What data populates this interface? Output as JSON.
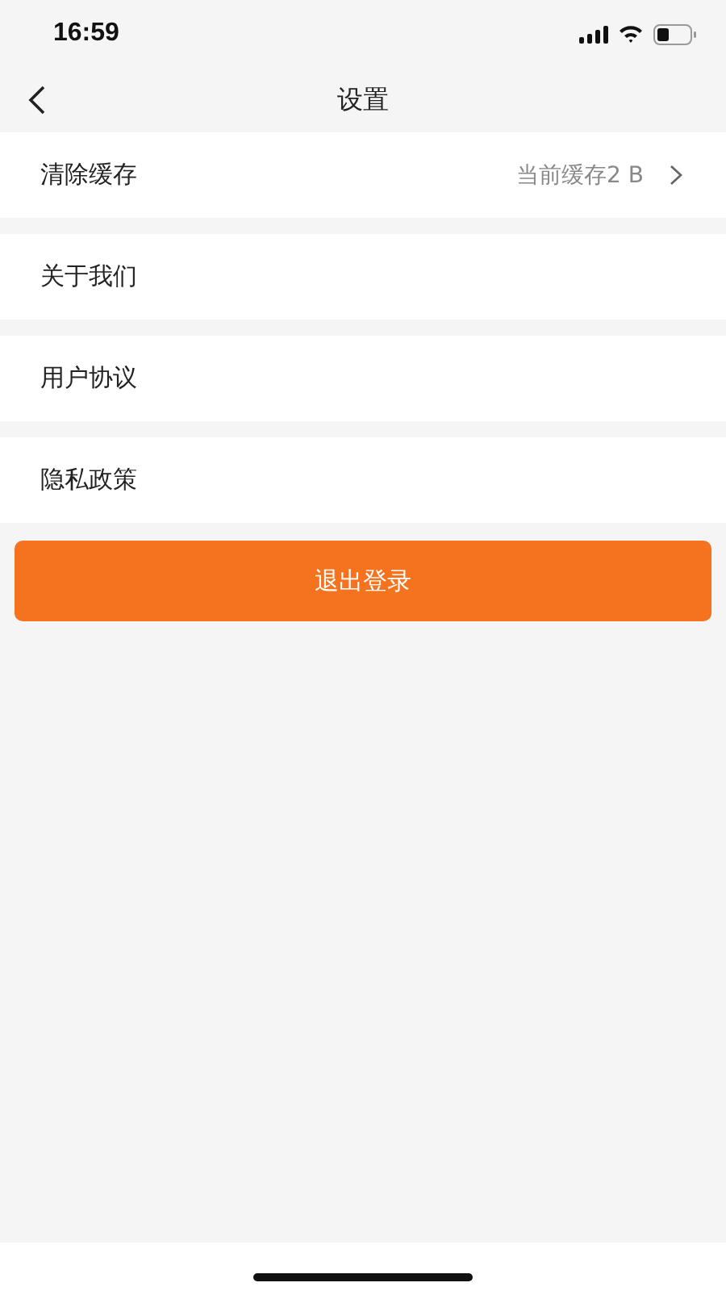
{
  "status_bar": {
    "time": "16:59"
  },
  "nav": {
    "title": "设置"
  },
  "rows": [
    {
      "label": "清除缓存",
      "value": "当前缓存2 B",
      "chevron": true
    },
    {
      "label": "关于我们",
      "chevron": false
    },
    {
      "label": "用户协议",
      "chevron": false
    },
    {
      "label": "隐私政策",
      "chevron": false
    }
  ],
  "logout_button": {
    "label": "退出登录"
  }
}
